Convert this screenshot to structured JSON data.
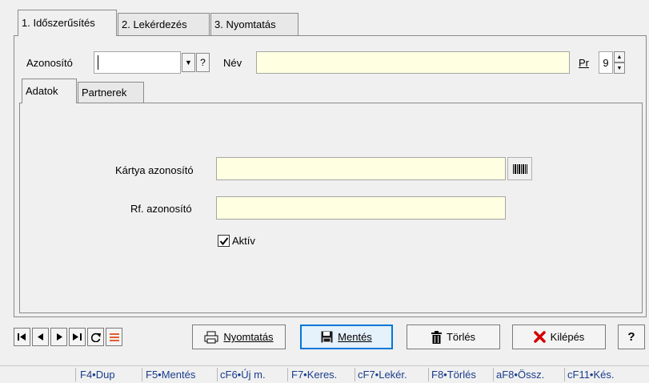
{
  "tabs": [
    {
      "label": "1. Időszerűsítés",
      "active": true
    },
    {
      "label": "2. Lekérdezés",
      "active": false
    },
    {
      "label": "3. Nyomtatás",
      "active": false
    }
  ],
  "form": {
    "azonosito_label": "Azonosító",
    "azonosito_value": "",
    "help_glyph": "?",
    "nev_label": "Név",
    "nev_value": "",
    "pr_label": "Pr",
    "pr_value": "9"
  },
  "inner_tabs": [
    {
      "label": "Adatok",
      "active": true
    },
    {
      "label": "Partnerek",
      "active": false
    }
  ],
  "fields": {
    "kartya_label": "Kártya azonosító",
    "kartya_value": "",
    "rf_label": "Rf. azonosító",
    "rf_value": "",
    "aktiv_label": "Aktív",
    "aktiv_checked": true
  },
  "buttons": {
    "print": "Nyomtatás",
    "save": "Mentés",
    "delete": "Törlés",
    "exit": "Kilépés",
    "help": "?"
  },
  "shortcuts": [
    "F4•Dup",
    "F5•Mentés",
    "cF6•Új m.",
    "F7•Keres.",
    "cF7•Lekér.",
    "F8•Törlés",
    "aF8•Össz.",
    "cF11•Kés."
  ],
  "colors": {
    "input_bg": "#ffffe1",
    "focus_border": "#0078d7",
    "statusbar_text": "#1a3d8c",
    "exit_icon": "#d40000"
  }
}
